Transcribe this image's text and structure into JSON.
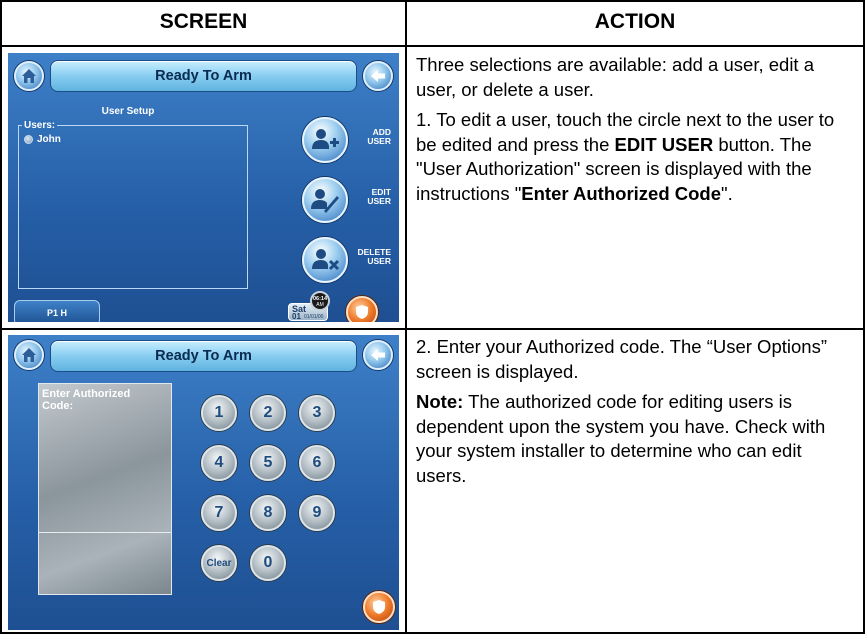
{
  "table": {
    "header_screen": "SCREEN",
    "header_action": "ACTION"
  },
  "row1": {
    "screen": {
      "title": "Ready To Arm",
      "subtitle": "User Setup",
      "users_label": "Users:",
      "user_name": "John",
      "add_label_1": "ADD",
      "add_label_2": "USER",
      "edit_label_1": "EDIT",
      "edit_label_2": "USER",
      "delete_label_1": "DELETE",
      "delete_label_2": "USER",
      "partition_button": "P1 H",
      "day": "Sat",
      "day_num": "01",
      "date": "01/01/00",
      "time": "06:14",
      "ampm": "AM"
    },
    "action": {
      "p1": "Three selections are available: add a user, edit a user, or delete a user.",
      "p2_a": "1. To edit a user, touch the circle next to the user to be edited and press the ",
      "p2_b": "EDIT USER",
      "p2_c": " button. The \"User Authorization\" screen is displayed with the instructions \"",
      "p2_d": "Enter Authorized Code",
      "p2_e": "\"."
    }
  },
  "row2": {
    "screen": {
      "title": "Ready To Arm",
      "display_text": "Enter Authorized Code:",
      "keys": [
        "1",
        "2",
        "3",
        "4",
        "5",
        "6",
        "7",
        "8",
        "9",
        "Clear",
        "0"
      ]
    },
    "action": {
      "p1": "2. Enter your Authorized code. The “User Options” screen is displayed.",
      "note_label": "Note:",
      "note_text": " The authorized code for editing users is dependent upon the system you have. Check with your system installer to determine who can edit users."
    }
  },
  "colors": {
    "screen_blue": "#2a66ae",
    "bar_light": "#88cdf0",
    "shield_orange": "#ee7a2a"
  }
}
